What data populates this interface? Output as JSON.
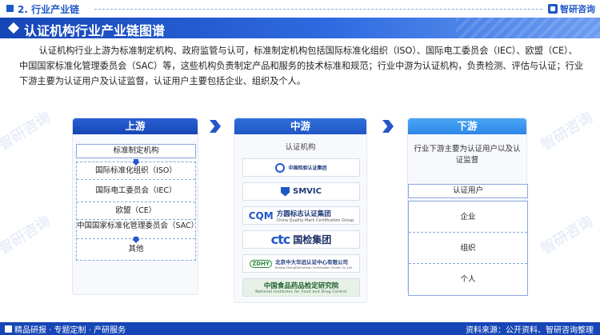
{
  "header": {
    "section": "2. 行业产业链",
    "brand": "智研咨询"
  },
  "banner": {
    "title": "认证机构行业产业链图谱"
  },
  "intro": "认证机构行业上游为标准制定机构、政府监管与认可，标准制定机构包括国际标准化组织（ISO）、国际电工委员会（IEC）、欧盟（CE）、中国国家标准化管理委员会（SAC）等，这些机构负责制定产品和服务的技术标准和规范；行业中游为认证机构，负责检测、评估与认证；行业下游主要为认证用户及认证监督，认证用户主要包括企业、组织及个人。",
  "watermark": "智研咨询",
  "upstream": {
    "title": "上游",
    "main": "标准制定机构",
    "items": [
      "国际标准化组织（ISO）",
      "国际电工委员会（IEC）",
      "欧盟（CE）",
      "中国国家标准化管理委员会（SAC）",
      "其他"
    ]
  },
  "midstream": {
    "title": "中游",
    "subtitle": "认证机构",
    "logos": [
      {
        "name": "中国检验认证集团"
      },
      {
        "name": "SMVIC"
      },
      {
        "mark": "CQM",
        "name": "方圆标志认证集团",
        "sub": "China Quality Mark Certification Group"
      },
      {
        "mark": "ctc",
        "name": "国检集团"
      },
      {
        "mark": "ZDHY",
        "name": "北京中大华远认证中心有限公司",
        "sub": "Beijing ZhongDaHuaYuan Certification Center Co.,Ltd."
      },
      {
        "name": "中国食品药品检定研究院",
        "sub": "National Institutes for Food and Drug Control"
      }
    ]
  },
  "downstream": {
    "title": "下游",
    "subtitle": "行业下游主要为认证用户以及认证监督",
    "main": "认证用户",
    "items": [
      "企业",
      "组织",
      "个人"
    ]
  },
  "footer": {
    "left": "精品研报 · 专题定制 · 产研服务",
    "right": "资料来源：公开资料、智研咨询整理"
  },
  "colors": {
    "primary": "#1f57c7",
    "banner_dark": "#1646b6",
    "downstream_head": "#2c86e8"
  }
}
